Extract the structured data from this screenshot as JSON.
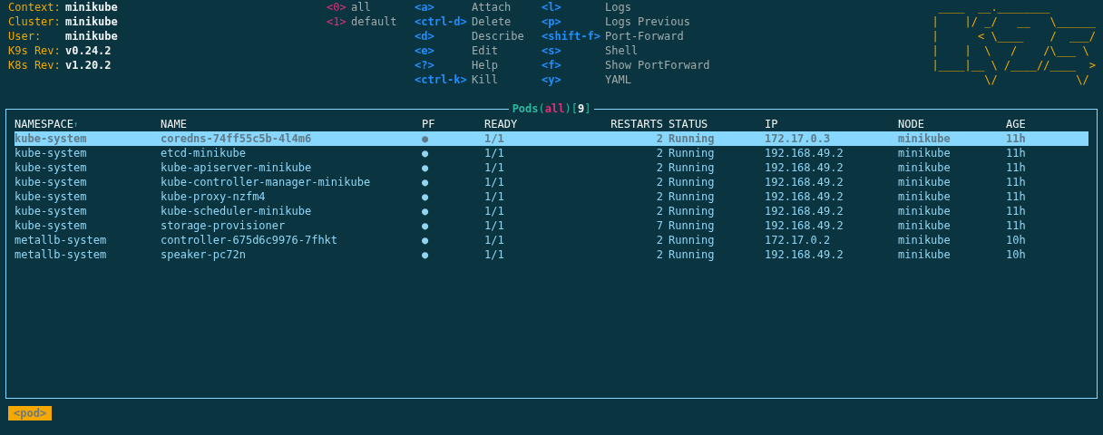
{
  "header": {
    "info": [
      {
        "label": "Context:",
        "value": "minikube"
      },
      {
        "label": "Cluster:",
        "value": "minikube"
      },
      {
        "label": "User:",
        "value": "minikube"
      },
      {
        "label": "K9s Rev:",
        "value": "v0.24.2"
      },
      {
        "label": "K8s Rev:",
        "value": "v1.20.2"
      }
    ],
    "namespaces": [
      {
        "key": "<0>",
        "label": "all"
      },
      {
        "key": "<1>",
        "label": "default"
      }
    ],
    "hotkey_columns": [
      {
        "items": [
          {
            "key": "<a>",
            "label": "Attach"
          },
          {
            "key": "<ctrl-d>",
            "label": "Delete"
          },
          {
            "key": "<d>",
            "label": "Describe"
          },
          {
            "key": "<e>",
            "label": "Edit"
          },
          {
            "key": "<?>",
            "label": "Help"
          },
          {
            "key": "<ctrl-k>",
            "label": "Kill"
          }
        ]
      },
      {
        "items": [
          {
            "key": "<l>",
            "label": "Logs"
          },
          {
            "key": "<p>",
            "label": "Logs Previous"
          },
          {
            "key": "<shift-f>",
            "label": "Port-Forward"
          },
          {
            "key": "<s>",
            "label": "Shell"
          },
          {
            "key": "<f>",
            "label": "Show PortForward"
          },
          {
            "key": "<y>",
            "label": "YAML"
          }
        ]
      }
    ],
    "logo": {
      "lines": [
        " ____  __.________",
        "|    |/ _/   __   \\______",
        "|      < \\____    /  ___/",
        "|    |  \\   /    /\\___ \\",
        "|____|__ \\ /____//____  >",
        "        \\/            \\/"
      ]
    }
  },
  "table": {
    "title": "Pods",
    "open_mark": "(",
    "filter": "all",
    "middle_mark": ")[",
    "count": "9",
    "close_mark": "]",
    "columns": [
      {
        "label": "NAMESPACE",
        "sort_mark": "↑"
      },
      {
        "label": "NAME"
      },
      {
        "label": "PF"
      },
      {
        "label": "READY"
      },
      {
        "label": "RESTARTS"
      },
      {
        "label": "STATUS"
      },
      {
        "label": "IP"
      },
      {
        "label": "NODE"
      },
      {
        "label": "AGE"
      }
    ],
    "rows": [
      {
        "selected": true,
        "cells": [
          "kube-system",
          "coredns-74ff55c5b-4l4m6",
          "●",
          "1/1",
          "2",
          "Running",
          "172.17.0.3",
          "minikube",
          "11h"
        ]
      },
      {
        "selected": false,
        "cells": [
          "kube-system",
          "etcd-minikube",
          "●",
          "1/1",
          "2",
          "Running",
          "192.168.49.2",
          "minikube",
          "11h"
        ]
      },
      {
        "selected": false,
        "cells": [
          "kube-system",
          "kube-apiserver-minikube",
          "●",
          "1/1",
          "2",
          "Running",
          "192.168.49.2",
          "minikube",
          "11h"
        ]
      },
      {
        "selected": false,
        "cells": [
          "kube-system",
          "kube-controller-manager-minikube",
          "●",
          "1/1",
          "2",
          "Running",
          "192.168.49.2",
          "minikube",
          "11h"
        ]
      },
      {
        "selected": false,
        "cells": [
          "kube-system",
          "kube-proxy-nzfm4",
          "●",
          "1/1",
          "2",
          "Running",
          "192.168.49.2",
          "minikube",
          "11h"
        ]
      },
      {
        "selected": false,
        "cells": [
          "kube-system",
          "kube-scheduler-minikube",
          "●",
          "1/1",
          "2",
          "Running",
          "192.168.49.2",
          "minikube",
          "11h"
        ]
      },
      {
        "selected": false,
        "cells": [
          "kube-system",
          "storage-provisioner",
          "●",
          "1/1",
          "7",
          "Running",
          "192.168.49.2",
          "minikube",
          "11h"
        ]
      },
      {
        "selected": false,
        "cells": [
          "metallb-system",
          "controller-675d6c9976-7fhkt",
          "●",
          "1/1",
          "2",
          "Running",
          "172.17.0.2",
          "minikube",
          "10h"
        ]
      },
      {
        "selected": false,
        "cells": [
          "metallb-system",
          "speaker-pc72n",
          "●",
          "1/1",
          "2",
          "Running",
          "192.168.49.2",
          "minikube",
          "10h"
        ]
      }
    ]
  },
  "crumbs": [
    {
      "label": "<pod>"
    }
  ]
}
